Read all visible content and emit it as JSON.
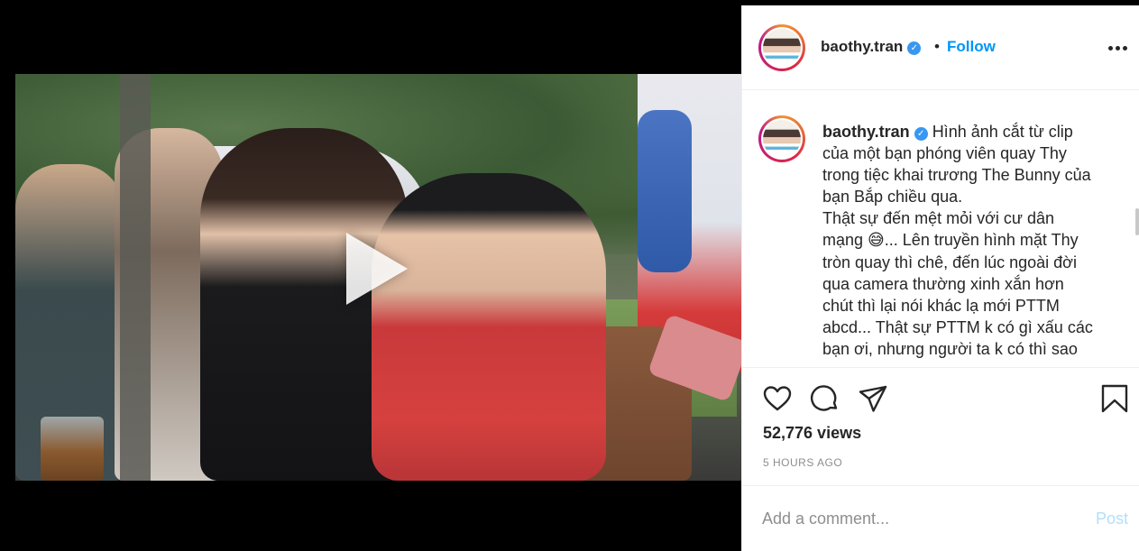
{
  "video": {
    "play_icon": "play-icon"
  },
  "header": {
    "username": "baothy.tran",
    "verified_icon": "verified-badge-icon",
    "verified_glyph": "✓",
    "separator": "•",
    "follow_label": "Follow",
    "more_icon": "more-options-icon"
  },
  "caption": {
    "username": "baothy.tran",
    "verified_glyph": "✓",
    "lines": [
      "Hình ảnh cắt từ clip",
      "của một bạn phóng viên quay Thy",
      "trong tiệc khai trương The Bunny của",
      "bạn Bắp chiều qua.",
      "Thật sự đến mệt mỏi với cư dân",
      "mạng 😅... Lên truyền hình mặt Thy",
      "tròn quay thì chê, đến lúc ngoài đời",
      "qua camera thường xinh xắn hơn",
      "chút thì lại nói khác lạ mới PTTM",
      "abcd... Thật sự PTTM k có gì xấu các",
      "bạn ơi, nhưng người ta k có thì sao"
    ]
  },
  "actions": {
    "like_icon": "heart-icon",
    "comment_icon": "comment-icon",
    "share_icon": "share-icon",
    "save_icon": "bookmark-icon",
    "views": "52,776 views",
    "time": "5 HOURS AGO"
  },
  "comment": {
    "placeholder": "Add a comment...",
    "post_label": "Post"
  },
  "colors": {
    "accent": "#0095f6",
    "verified": "#3897f0",
    "post_disabled": "#b2dffc",
    "text": "#262626",
    "muted": "#8e8e8e"
  }
}
